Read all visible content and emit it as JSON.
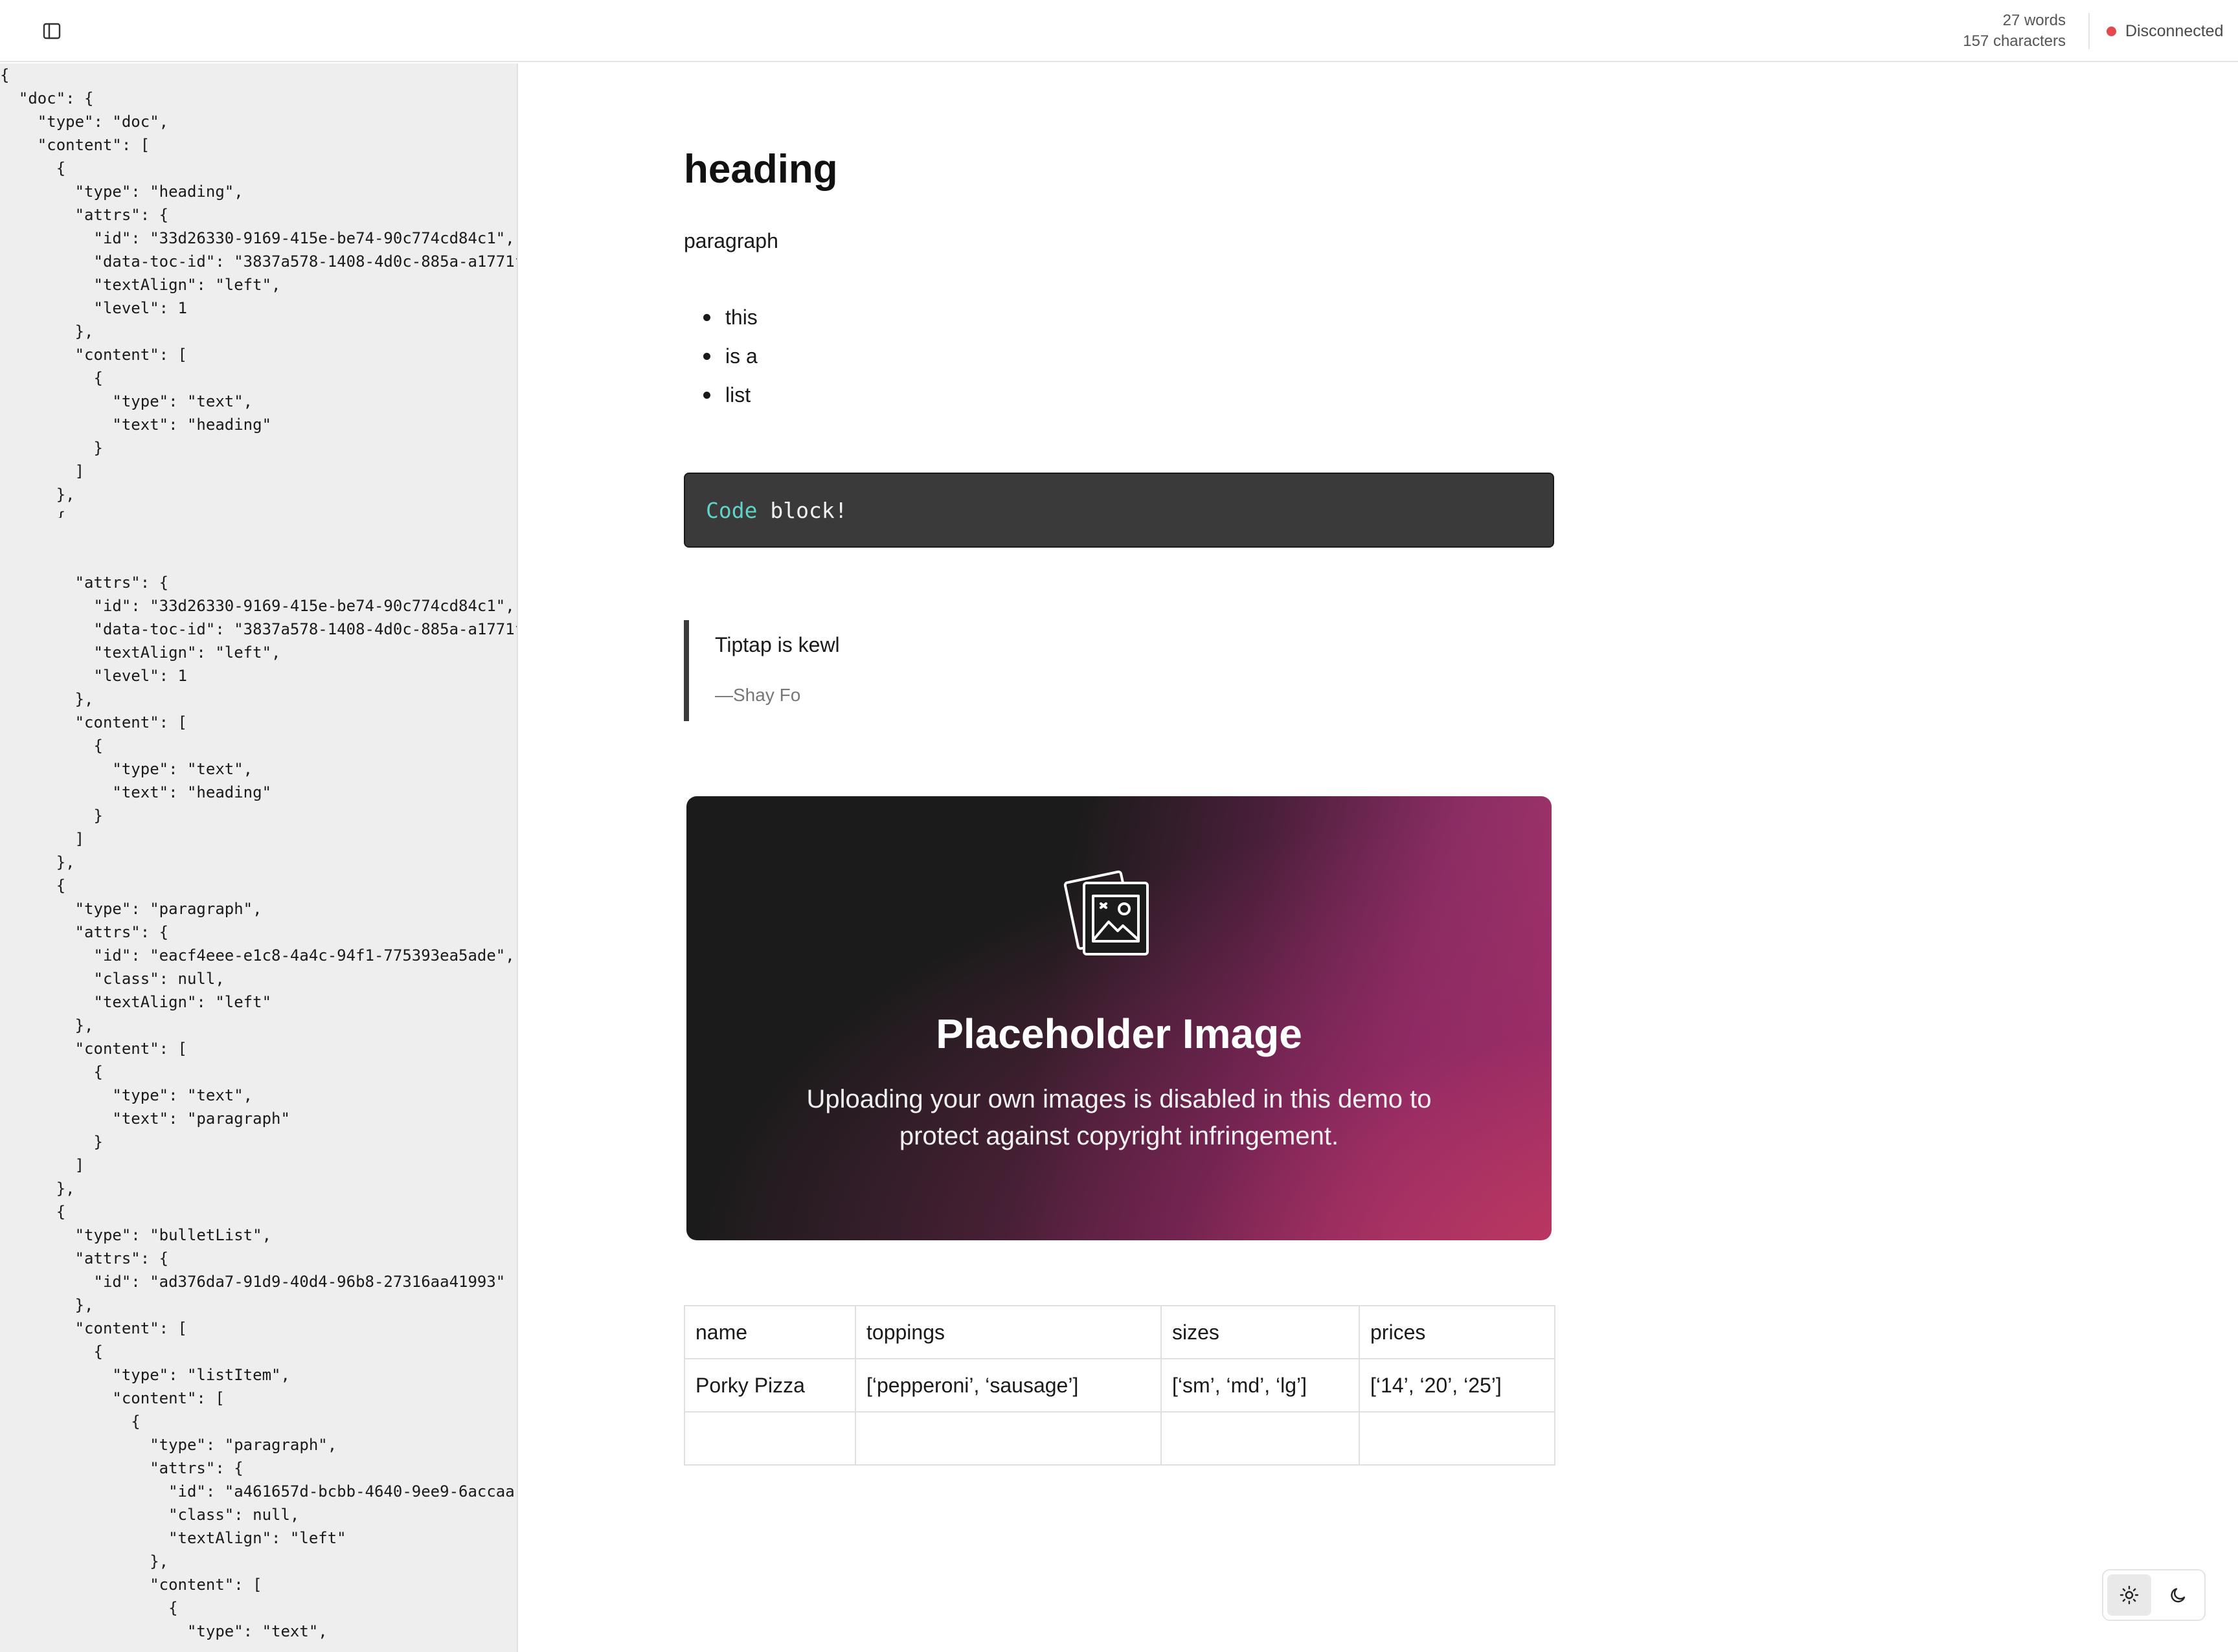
{
  "header": {
    "word_count": "27 words",
    "char_count": "157 characters",
    "status_label": "Disconnected",
    "status_color": "#e5484d"
  },
  "json_panel": {
    "text_top": "{\n  \"doc\": {\n    \"type\": \"doc\",\n    \"content\": [\n      {\n        \"type\": \"heading\",\n        \"attrs\": {\n          \"id\": \"33d26330-9169-415e-be74-90c774cd84c1\",\n          \"data-toc-id\": \"3837a578-1408-4d0c-885a-a1771f\n          \"textAlign\": \"left\",\n          \"level\": 1\n        },\n        \"content\": [\n          {\n            \"type\": \"text\",\n            \"text\": \"heading\"\n          }\n        ]\n      },\n      {\n        \"type\": \"paragraph\",",
    "text_rest": "        \"attrs\": {\n          \"id\": \"33d26330-9169-415e-be74-90c774cd84c1\",\n          \"data-toc-id\": \"3837a578-1408-4d0c-885a-a1771f\n          \"textAlign\": \"left\",\n          \"level\": 1\n        },\n        \"content\": [\n          {\n            \"type\": \"text\",\n            \"text\": \"heading\"\n          }\n        ]\n      },\n      {\n        \"type\": \"paragraph\",\n        \"attrs\": {\n          \"id\": \"eacf4eee-e1c8-4a4c-94f1-775393ea5ade\",\n          \"class\": null,\n          \"textAlign\": \"left\"\n        },\n        \"content\": [\n          {\n            \"type\": \"text\",\n            \"text\": \"paragraph\"\n          }\n        ]\n      },\n      {\n        \"type\": \"bulletList\",\n        \"attrs\": {\n          \"id\": \"ad376da7-91d9-40d4-96b8-27316aa41993\"\n        },\n        \"content\": [\n          {\n            \"type\": \"listItem\",\n            \"content\": [\n              {\n                \"type\": \"paragraph\",\n                \"attrs\": {\n                  \"id\": \"a461657d-bcbb-4640-9ee9-6accaa\n                  \"class\": null,\n                  \"textAlign\": \"left\"\n                },\n                \"content\": [\n                  {\n                    \"type\": \"text\","
  },
  "editor": {
    "heading": "heading",
    "paragraph": "paragraph",
    "list": [
      "this",
      "is a",
      "list"
    ],
    "code_keyword": "Code",
    "code_rest": " block!",
    "quote_text": "Tiptap is kewl",
    "quote_author": "—Shay Fo",
    "image_title": "Placeholder Image",
    "image_desc": "Uploading your own images is disabled in this demo to protect against copyright infringement.",
    "table": {
      "headers": [
        "name",
        "toppings",
        "sizes",
        "prices"
      ],
      "rows": [
        [
          "Porky Pizza",
          "[‘pepperoni’, ‘sausage’]",
          "[‘sm’, ‘md’, ‘lg’]",
          "[‘14’, ‘20’, ‘25’]"
        ],
        [
          "",
          "",
          "",
          ""
        ]
      ]
    }
  },
  "icons": {
    "sidebar_toggle": "sidebar-toggle-icon",
    "status": "status-dot",
    "image": "image-gallery-icon",
    "light": "sun-icon",
    "dark": "moon-icon"
  },
  "theme": {
    "active": "light"
  }
}
